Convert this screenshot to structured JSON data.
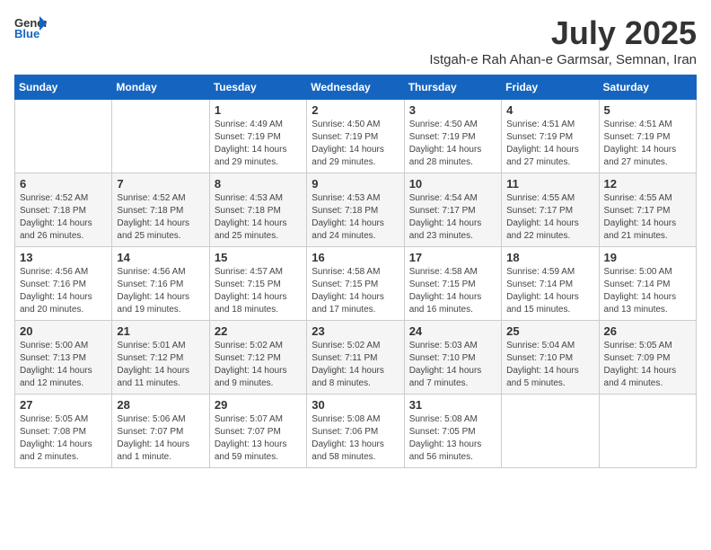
{
  "header": {
    "logo_general": "General",
    "logo_blue": "Blue",
    "month": "July 2025",
    "location": "Istgah-e Rah Ahan-e Garmsar, Semnan, Iran"
  },
  "days_of_week": [
    "Sunday",
    "Monday",
    "Tuesday",
    "Wednesday",
    "Thursday",
    "Friday",
    "Saturday"
  ],
  "weeks": [
    [
      {
        "day": "",
        "info": ""
      },
      {
        "day": "",
        "info": ""
      },
      {
        "day": "1",
        "info": "Sunrise: 4:49 AM\nSunset: 7:19 PM\nDaylight: 14 hours and 29 minutes."
      },
      {
        "day": "2",
        "info": "Sunrise: 4:50 AM\nSunset: 7:19 PM\nDaylight: 14 hours and 29 minutes."
      },
      {
        "day": "3",
        "info": "Sunrise: 4:50 AM\nSunset: 7:19 PM\nDaylight: 14 hours and 28 minutes."
      },
      {
        "day": "4",
        "info": "Sunrise: 4:51 AM\nSunset: 7:19 PM\nDaylight: 14 hours and 27 minutes."
      },
      {
        "day": "5",
        "info": "Sunrise: 4:51 AM\nSunset: 7:19 PM\nDaylight: 14 hours and 27 minutes."
      }
    ],
    [
      {
        "day": "6",
        "info": "Sunrise: 4:52 AM\nSunset: 7:18 PM\nDaylight: 14 hours and 26 minutes."
      },
      {
        "day": "7",
        "info": "Sunrise: 4:52 AM\nSunset: 7:18 PM\nDaylight: 14 hours and 25 minutes."
      },
      {
        "day": "8",
        "info": "Sunrise: 4:53 AM\nSunset: 7:18 PM\nDaylight: 14 hours and 25 minutes."
      },
      {
        "day": "9",
        "info": "Sunrise: 4:53 AM\nSunset: 7:18 PM\nDaylight: 14 hours and 24 minutes."
      },
      {
        "day": "10",
        "info": "Sunrise: 4:54 AM\nSunset: 7:17 PM\nDaylight: 14 hours and 23 minutes."
      },
      {
        "day": "11",
        "info": "Sunrise: 4:55 AM\nSunset: 7:17 PM\nDaylight: 14 hours and 22 minutes."
      },
      {
        "day": "12",
        "info": "Sunrise: 4:55 AM\nSunset: 7:17 PM\nDaylight: 14 hours and 21 minutes."
      }
    ],
    [
      {
        "day": "13",
        "info": "Sunrise: 4:56 AM\nSunset: 7:16 PM\nDaylight: 14 hours and 20 minutes."
      },
      {
        "day": "14",
        "info": "Sunrise: 4:56 AM\nSunset: 7:16 PM\nDaylight: 14 hours and 19 minutes."
      },
      {
        "day": "15",
        "info": "Sunrise: 4:57 AM\nSunset: 7:15 PM\nDaylight: 14 hours and 18 minutes."
      },
      {
        "day": "16",
        "info": "Sunrise: 4:58 AM\nSunset: 7:15 PM\nDaylight: 14 hours and 17 minutes."
      },
      {
        "day": "17",
        "info": "Sunrise: 4:58 AM\nSunset: 7:15 PM\nDaylight: 14 hours and 16 minutes."
      },
      {
        "day": "18",
        "info": "Sunrise: 4:59 AM\nSunset: 7:14 PM\nDaylight: 14 hours and 15 minutes."
      },
      {
        "day": "19",
        "info": "Sunrise: 5:00 AM\nSunset: 7:14 PM\nDaylight: 14 hours and 13 minutes."
      }
    ],
    [
      {
        "day": "20",
        "info": "Sunrise: 5:00 AM\nSunset: 7:13 PM\nDaylight: 14 hours and 12 minutes."
      },
      {
        "day": "21",
        "info": "Sunrise: 5:01 AM\nSunset: 7:12 PM\nDaylight: 14 hours and 11 minutes."
      },
      {
        "day": "22",
        "info": "Sunrise: 5:02 AM\nSunset: 7:12 PM\nDaylight: 14 hours and 9 minutes."
      },
      {
        "day": "23",
        "info": "Sunrise: 5:02 AM\nSunset: 7:11 PM\nDaylight: 14 hours and 8 minutes."
      },
      {
        "day": "24",
        "info": "Sunrise: 5:03 AM\nSunset: 7:10 PM\nDaylight: 14 hours and 7 minutes."
      },
      {
        "day": "25",
        "info": "Sunrise: 5:04 AM\nSunset: 7:10 PM\nDaylight: 14 hours and 5 minutes."
      },
      {
        "day": "26",
        "info": "Sunrise: 5:05 AM\nSunset: 7:09 PM\nDaylight: 14 hours and 4 minutes."
      }
    ],
    [
      {
        "day": "27",
        "info": "Sunrise: 5:05 AM\nSunset: 7:08 PM\nDaylight: 14 hours and 2 minutes."
      },
      {
        "day": "28",
        "info": "Sunrise: 5:06 AM\nSunset: 7:07 PM\nDaylight: 14 hours and 1 minute."
      },
      {
        "day": "29",
        "info": "Sunrise: 5:07 AM\nSunset: 7:07 PM\nDaylight: 13 hours and 59 minutes."
      },
      {
        "day": "30",
        "info": "Sunrise: 5:08 AM\nSunset: 7:06 PM\nDaylight: 13 hours and 58 minutes."
      },
      {
        "day": "31",
        "info": "Sunrise: 5:08 AM\nSunset: 7:05 PM\nDaylight: 13 hours and 56 minutes."
      },
      {
        "day": "",
        "info": ""
      },
      {
        "day": "",
        "info": ""
      }
    ]
  ]
}
